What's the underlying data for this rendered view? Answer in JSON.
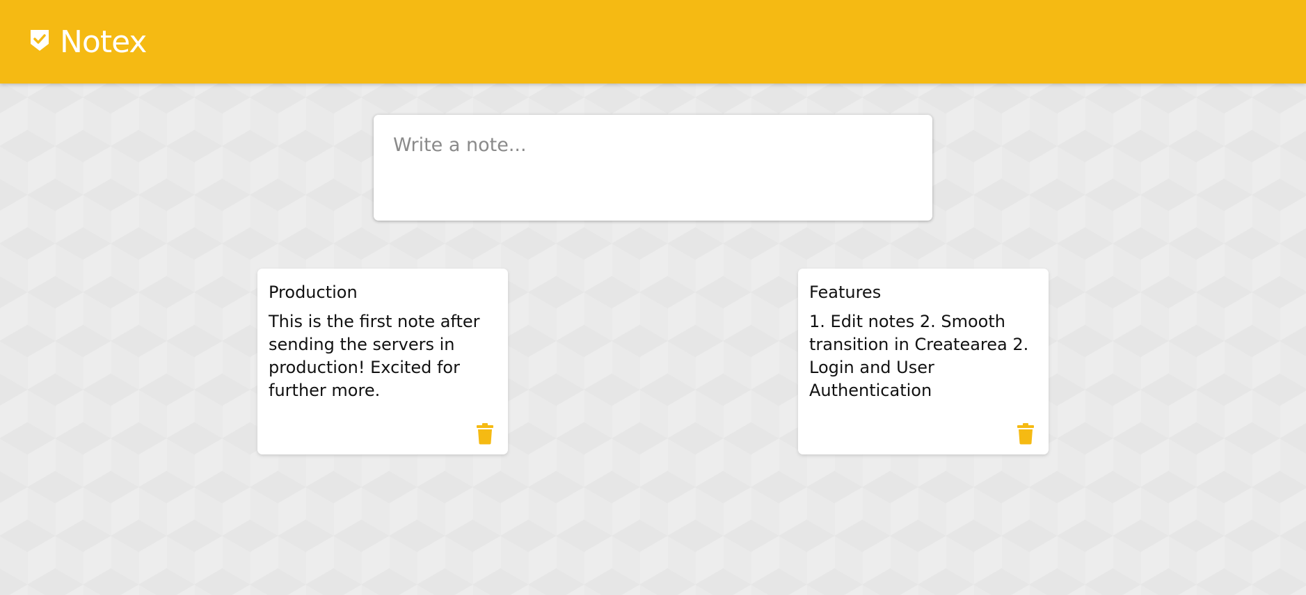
{
  "app": {
    "title": "Notex",
    "accent_color": "#f5ba13",
    "logo_icon": "check-shield-icon"
  },
  "create_area": {
    "placeholder": "Write a note...",
    "value": ""
  },
  "notes": [
    {
      "title": "Production",
      "content": "This is the first note after sending the servers in production! Excited for further more.",
      "delete_icon": "trash-icon"
    },
    {
      "title": "Features",
      "content": "1. Edit notes 2. Smooth transition in Createarea 2. Login and User Authentication",
      "delete_icon": "trash-icon"
    }
  ]
}
